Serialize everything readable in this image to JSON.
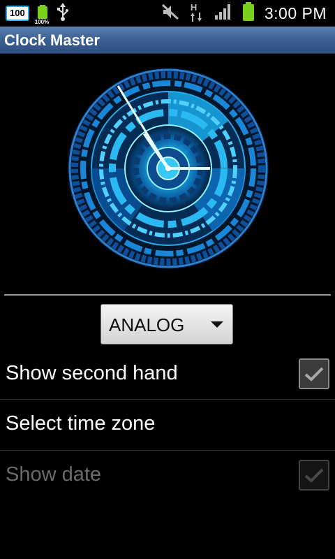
{
  "status_bar": {
    "badge_value": "100",
    "battery_small_percent": "100%",
    "network_type": "H",
    "time": "3:00 PM"
  },
  "app": {
    "title": "Clock Master"
  },
  "clock": {
    "style": "futuristic blue analog"
  },
  "spinner": {
    "selected": "ANALOG"
  },
  "settings": [
    {
      "label": "Show second hand",
      "checked": true,
      "enabled": true
    },
    {
      "label": "Select time zone",
      "enabled": true
    },
    {
      "label": "Show date",
      "checked": true,
      "enabled": false
    }
  ],
  "colors": {
    "title_bar": "#3c5f92",
    "accent": "#2aa5e6",
    "clock_cyan": "#3fd0ff"
  }
}
